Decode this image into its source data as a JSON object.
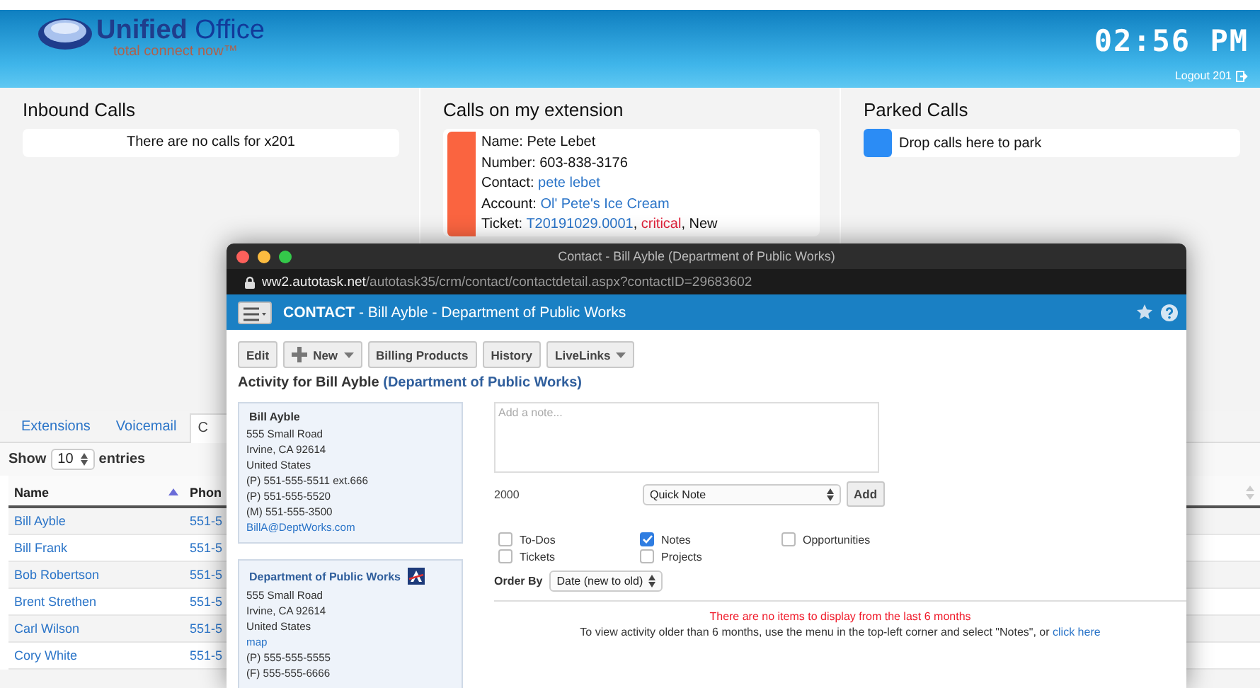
{
  "header": {
    "logo_name_a": "Unified",
    "logo_name_b": "Office",
    "logo_tagline": "total connect now™",
    "clock": "02:56 PM",
    "logout": "Logout 201"
  },
  "panels": [
    {
      "title": "Inbound Calls",
      "kind": "message",
      "message": "There are no calls for x201"
    },
    {
      "title": "Calls on my extension",
      "kind": "call",
      "color": "#fa6440",
      "lines": [
        [
          {
            "text": "Name: Pete Lebet",
            "kind": "plain"
          }
        ],
        [
          {
            "text": "Number: 603-838-3176",
            "kind": "plain"
          }
        ],
        [
          {
            "text": "Contact: ",
            "kind": "plain"
          },
          {
            "text": "pete lebet",
            "kind": "link"
          }
        ],
        [
          {
            "text": "Account: ",
            "kind": "plain"
          },
          {
            "text": "Ol' Pete's Ice Cream",
            "kind": "link"
          }
        ],
        [
          {
            "text": "Ticket: ",
            "kind": "plain"
          },
          {
            "text": "T20191029.0001",
            "kind": "link"
          },
          {
            "text": ", ",
            "kind": "plain"
          },
          {
            "text": "critical",
            "kind": "alert"
          },
          {
            "text": ", New",
            "kind": "plain"
          }
        ]
      ]
    },
    {
      "title": "Parked Calls",
      "kind": "park",
      "color": "#2b8cf5",
      "message": "Drop calls here to park"
    }
  ],
  "tabs": [
    {
      "label": "Extensions",
      "selected": false
    },
    {
      "label": "Voicemail",
      "selected": false
    },
    {
      "label": "C",
      "selected": true
    }
  ],
  "table": {
    "show_label": "Show",
    "length": "10",
    "entries_label": "entries",
    "columns": [
      "Name",
      "Phon"
    ],
    "rows": [
      [
        "Bill Ayble",
        "551-5"
      ],
      [
        "Bill Frank",
        "551-5"
      ],
      [
        "Bob Robertson",
        "551-5"
      ],
      [
        "Brent Strethen",
        "551-5"
      ],
      [
        "Carl Wilson",
        "551-5"
      ],
      [
        "Cory White",
        "551-5"
      ]
    ]
  },
  "popup": {
    "title": "Contact - Bill Ayble (Department of Public Works)",
    "url_host": "ww2.autotask.net",
    "url_path": "/autotask35/crm/contact/contactdetail.aspx?contactID=29683602",
    "heading_kind": "CONTACT",
    "heading_rest": " - Bill Ayble - Department of Public Works",
    "toolbar": [
      {
        "label": "Edit",
        "kind": "plain"
      },
      {
        "label": "New",
        "kind": "add-menu"
      },
      {
        "label": "Billing Products",
        "kind": "plain"
      },
      {
        "label": "History",
        "kind": "plain"
      },
      {
        "label": "LiveLinks",
        "kind": "menu"
      }
    ],
    "activity_title": [
      {
        "text": "Activity for Bill Ayble ",
        "kind": "plain"
      },
      {
        "text": "(Department of Public Works)",
        "kind": "accent"
      }
    ],
    "cards": [
      {
        "kind": "contact",
        "name": "Bill Ayble",
        "lines": [
          {
            "text": "555 Small Road",
            "kind": "text"
          },
          {
            "text": "Irvine, CA 92614",
            "kind": "text"
          },
          {
            "text": "United States",
            "kind": "text"
          },
          {
            "text": "(P) 551-555-5511 ext.666",
            "kind": "text"
          },
          {
            "text": "(P) 551-555-5520",
            "kind": "text"
          },
          {
            "text": "(M) 551-555-3500",
            "kind": "text"
          },
          {
            "text": "BillA@DeptWorks.com",
            "kind": "link"
          }
        ]
      },
      {
        "kind": "company",
        "name": "Department of Public Works",
        "lines": [
          {
            "text": "555 Small Road",
            "kind": "text"
          },
          {
            "text": "Irvine, CA 92614",
            "kind": "text"
          },
          {
            "text": "United States",
            "kind": "text"
          },
          {
            "text": "map",
            "kind": "link"
          },
          {
            "text": "(P) 555-555-5555",
            "kind": "text"
          },
          {
            "text": "(F) 555-555-6666",
            "kind": "text"
          }
        ]
      }
    ],
    "note": {
      "placeholder": "Add a note...",
      "counter": "2000",
      "type": "Quick Note",
      "add": "Add"
    },
    "filters": [
      {
        "label": "To-Dos",
        "checked": false
      },
      {
        "label": "Notes",
        "checked": true
      },
      {
        "label": "Opportunities",
        "checked": false
      },
      {
        "label": "Tickets",
        "checked": false
      },
      {
        "label": "Projects",
        "checked": false
      }
    ],
    "order_by": {
      "label": "Order By",
      "value": "Date (new to old)"
    },
    "empty_message": "There are no items to display from the last 6 months",
    "older_message": [
      {
        "text": "To view activity older than 6 months, use the menu in the top-left corner and select \"Notes\", or ",
        "kind": "plain"
      },
      {
        "text": "click here",
        "kind": "link"
      }
    ]
  }
}
